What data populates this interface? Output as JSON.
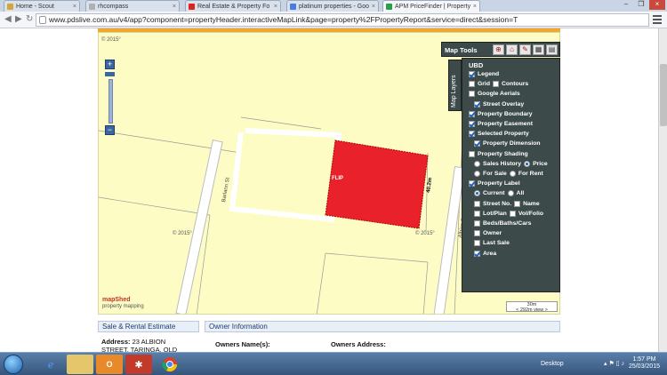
{
  "browser": {
    "tabs": [
      {
        "title": "Home - Scout",
        "color": "#d6a43a"
      },
      {
        "title": "rhcompass",
        "color": "#b0b0b0"
      },
      {
        "title": "Real Estate & Property Fo",
        "color": "#d22"
      },
      {
        "title": "platinum properties - Goo",
        "color": "#4a7de0"
      },
      {
        "title": "APM PriceFinder | Property",
        "color": "#2aa04a"
      }
    ],
    "url": "www.pdslive.com.au/v4/app?component=propertyHeader.interactiveMapLink&page=property%2FPropertyReport&service=direct&session=T"
  },
  "map": {
    "copyright": "© 2015°",
    "roads": [
      "Barlann St",
      "Albion St"
    ],
    "parcel_label": "FLIP",
    "dimension_label": "40.2m",
    "logo": {
      "name": "mapShed",
      "tagline": "property mapping"
    },
    "scale": {
      "distance": "30m",
      "width": "< 292m view >"
    }
  },
  "map_tools": {
    "label": "Map Tools",
    "icons": [
      "pan-icon",
      "home-icon",
      "measure-icon",
      "layers-icon",
      "print-icon"
    ]
  },
  "map_layers": {
    "tab_label": "Map Layers",
    "header": "UBD",
    "items": [
      {
        "kind": "checkbox",
        "label": "Legend",
        "checked": true,
        "indent": 0
      },
      {
        "kind": "checkbox",
        "label": "Grid",
        "checked": false,
        "indent": 0,
        "pair_label": "Contours",
        "pair_checked": false
      },
      {
        "kind": "checkbox",
        "label": "Google Aerials",
        "checked": false,
        "indent": 0
      },
      {
        "kind": "checkbox",
        "label": "Street Overlay",
        "checked": true,
        "indent": 1
      },
      {
        "kind": "checkbox",
        "label": "Property Boundary",
        "checked": true,
        "indent": 0
      },
      {
        "kind": "checkbox",
        "label": "Property Easement",
        "checked": true,
        "indent": 0
      },
      {
        "kind": "checkbox",
        "label": "Selected Property",
        "checked": true,
        "indent": 0
      },
      {
        "kind": "checkbox",
        "label": "Property Dimension",
        "checked": true,
        "indent": 1
      },
      {
        "kind": "checkbox",
        "label": "Property Shading",
        "checked": false,
        "indent": 0
      },
      {
        "kind": "radio",
        "label": "Sales History",
        "checked": false,
        "indent": 1,
        "pair_label": "Price",
        "pair_checked": true
      },
      {
        "kind": "radio",
        "label": "For Sale",
        "checked": false,
        "indent": 1,
        "pair_label": "For Rent",
        "pair_checked": false
      },
      {
        "kind": "checkbox",
        "label": "Property Label",
        "checked": true,
        "indent": 0
      },
      {
        "kind": "radio",
        "label": "Current",
        "checked": true,
        "indent": 1,
        "pair_label": "All",
        "pair_checked": false
      },
      {
        "kind": "checkbox",
        "label": "Street No.",
        "checked": false,
        "indent": 1,
        "pair_label": "Name",
        "pair_checked": false
      },
      {
        "kind": "checkbox",
        "label": "Lot/Plan",
        "checked": false,
        "indent": 1,
        "pair_label": "Vol/Folio",
        "pair_checked": false
      },
      {
        "kind": "checkbox",
        "label": "Beds/Baths/Cars",
        "checked": false,
        "indent": 1
      },
      {
        "kind": "checkbox",
        "label": "Owner",
        "checked": false,
        "indent": 1
      },
      {
        "kind": "checkbox",
        "label": "Last Sale",
        "checked": false,
        "indent": 1
      },
      {
        "kind": "checkbox",
        "label": "Area",
        "checked": true,
        "indent": 1
      }
    ]
  },
  "sale_panel": {
    "title": "Sale & Rental Estimate",
    "address_label": "Address:",
    "address_line1": "23 ALBION",
    "address_line2": "STREET, TARINGA, QLD"
  },
  "owner_panel": {
    "title": "Owner Information",
    "col1": "Owners Name(s):",
    "col2": "Owners Address:"
  },
  "taskbar": {
    "desktop_label": "Desktop",
    "time": "1:57 PM",
    "date": "25/03/2015"
  }
}
